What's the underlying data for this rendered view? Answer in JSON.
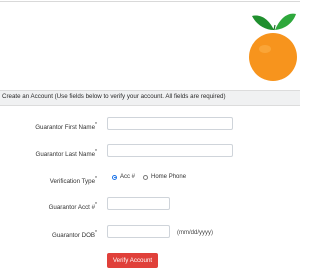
{
  "header": {
    "logo_icon": "orange-fruit-logo",
    "colors": {
      "orange": "#f7941d",
      "leaf": "#2e9e3a"
    }
  },
  "banner": {
    "text": "Create an Account (Use fields below to verify your account. All fields are required)"
  },
  "form": {
    "first_name_label": "Guarantor First Name",
    "last_name_label": "Guarantor Last Name",
    "verification_type_label": "Verification Type",
    "verification_options": [
      "Acc #",
      "Home Phone"
    ],
    "verification_selected": "Acc #",
    "acct_label": "Guarantor Acct #",
    "dob_label": "Guarantor DOB",
    "dob_hint": "(mm/dd/yyyy)",
    "required_mark": "*"
  },
  "actions": {
    "verify_label": "Verify Account",
    "verify_color": "#e0403a"
  }
}
